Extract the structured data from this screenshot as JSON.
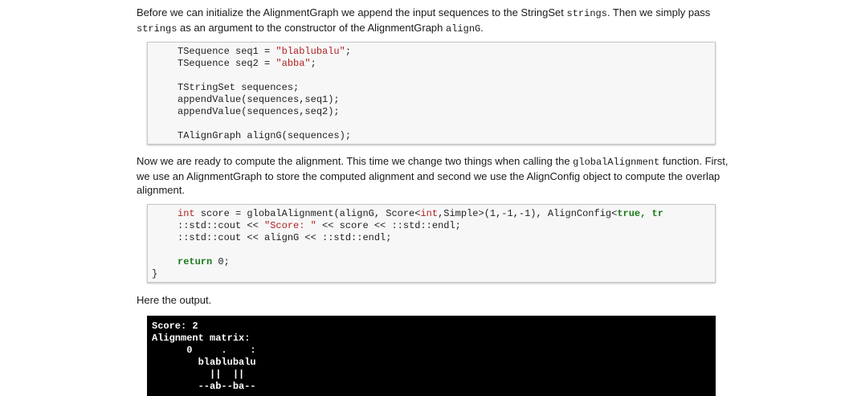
{
  "para1": {
    "t1": "Before we can initialize the AlignmentGraph we append the input sequences to the StringSet ",
    "c1": "strings",
    "t2": ". Then we simply pass ",
    "c2": "strings",
    "t3": " as an argument to the constructor of the AlignmentGraph ",
    "c3": "alignG",
    "t4": "."
  },
  "code1": {
    "l1a": "TSequence seq1 = ",
    "l1b": "\"blablubalu\"",
    "l1c": ";",
    "l2a": "TSequence seq2 = ",
    "l2b": "\"abba\"",
    "l2c": ";",
    "l3": "TStringSet sequences;",
    "l4": "appendValue(sequences,seq1);",
    "l5": "appendValue(sequences,seq2);",
    "l6": "TAlignGraph alignG(sequences);"
  },
  "para2": {
    "t1": "Now we are ready to compute the alignment. This time we change two things when calling the ",
    "c1": "globalAlignment",
    "t2": " function. First, we use an AlignmentGraph to store the computed alignment and second we use the AlignConfig object to compute the overlap alignment."
  },
  "code2": {
    "l1_int": "int",
    "l1a": " score = globalAlignment(alignG, Score<",
    "l1_int2": "int",
    "l1b": ",Simple>(1,-1,-1), AlignConfig<",
    "l1_true": "true",
    "l1c": ", tr",
    "l2a": "::std::cout << ",
    "l2_str": "\"Score: \"",
    "l2b": " << score << ::std::endl;",
    "l3": "::std::cout << alignG << ::std::endl;",
    "l4_kw": "return",
    "l4b": " 0;",
    "brace": "}"
  },
  "para3": {
    "text": "Here the output."
  },
  "terminal": {
    "l1": "Score: 2",
    "l2": "Alignment matrix:",
    "l3": "      0     .    :",
    "l4": "        blablubalu",
    "l5": "          ||  ||",
    "l6": "        --ab--ba--"
  }
}
